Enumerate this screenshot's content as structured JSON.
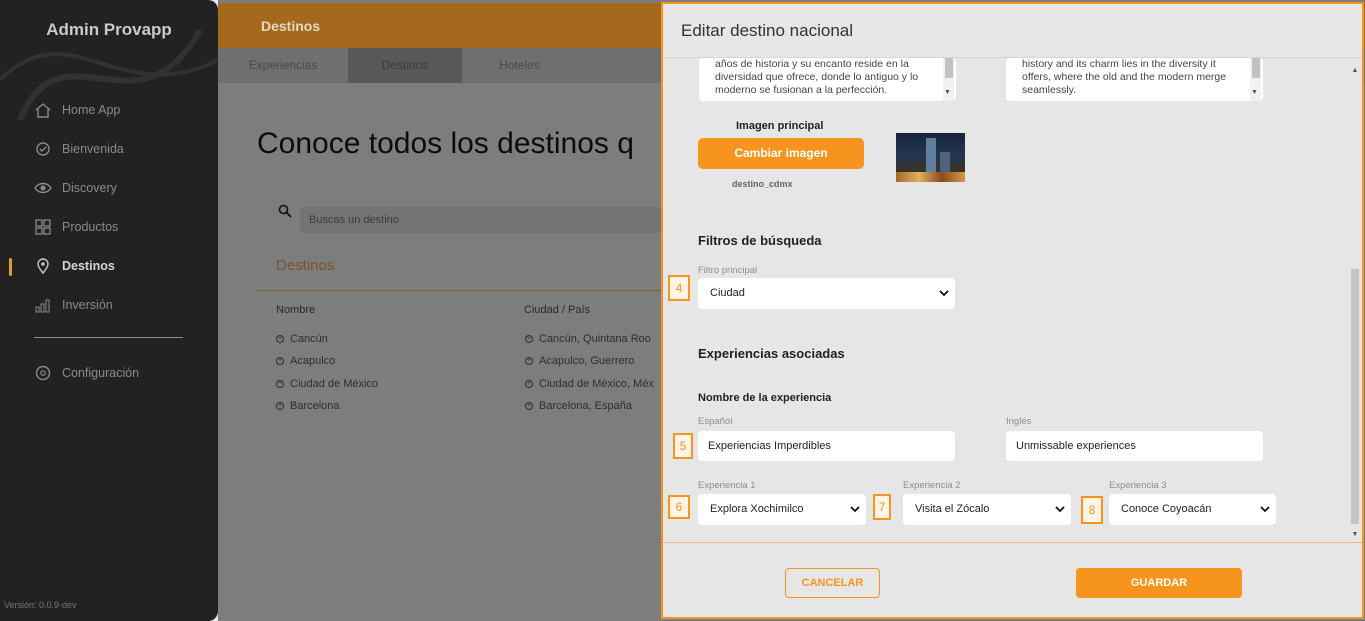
{
  "sidebar": {
    "brand": "Admin Provapp",
    "items": [
      {
        "label": "Home App",
        "icon": "home-icon"
      },
      {
        "label": "Bienvenida",
        "icon": "welcome-icon"
      },
      {
        "label": "Discovery",
        "icon": "eye-icon"
      },
      {
        "label": "Productos",
        "icon": "grid-icon"
      },
      {
        "label": "Destinos",
        "icon": "location-pin-icon",
        "active": true
      },
      {
        "label": "Inversión",
        "icon": "chart-icon"
      }
    ],
    "settings": {
      "label": "Configuración",
      "icon": "gear-icon"
    },
    "version": "Versión: 0.0.9-dev"
  },
  "topbar": {
    "title": "Destinos"
  },
  "tabs": [
    {
      "label": "Experiencias"
    },
    {
      "label": "Destinos",
      "active": true
    },
    {
      "label": "Hoteles"
    }
  ],
  "main": {
    "heading": "Conoce todos los destinos q",
    "search_placeholder": "Buscas un destino",
    "section_title": "Destinos",
    "columns": [
      "Nombre",
      "Ciudad / País"
    ],
    "rows": [
      {
        "name": "Cancún",
        "city": "Cancún, Quintana Roo"
      },
      {
        "name": "Acapulco",
        "city": "Acapulco, Guerrero"
      },
      {
        "name": "Ciudad de México",
        "city": "Ciudad de México, Méx"
      },
      {
        "name": "Barcelona",
        "city": "Barcelona, España"
      }
    ]
  },
  "modal": {
    "title": "Editar destino nacional",
    "description_es": "años de historia y su encanto reside en la diversidad que ofrece, donde lo antiguo y lo moderno se fusionan a la perfección.",
    "description_en": "history and its charm lies in the diversity it offers, where the old and the modern merge seamlessly.",
    "image_label": "Imagen principal",
    "change_image_label": "Cambiar imagen",
    "image_filename": "destino_cdmx",
    "filters_title": "Filtros de búsqueda",
    "filter_label": "Filtro principal",
    "filter_value": "Ciudad",
    "experiences_title": "Experiencias asociadas",
    "experience_name_label": "Nombre de la experiencia",
    "lang_es_label": "Español",
    "lang_en_label": "Inglés",
    "experience_name_es": "Experiencias Imperdibles",
    "experience_name_en": "Unmissable experiences",
    "exp1_label": "Experiencia 1",
    "exp1_value": "Explora Xochimilco",
    "exp2_label": "Experiencia 2",
    "exp2_value": "Visita el Zócalo",
    "exp3_label": "Experiencia 3",
    "exp3_value": "Conoce Coyoacán",
    "cancel_label": "CANCELAR",
    "save_label": "GUARDAR"
  },
  "markers": [
    "4",
    "5",
    "6",
    "7",
    "8"
  ],
  "colors": {
    "accent": "#f7941d",
    "sidebar_bg": "#222222"
  }
}
